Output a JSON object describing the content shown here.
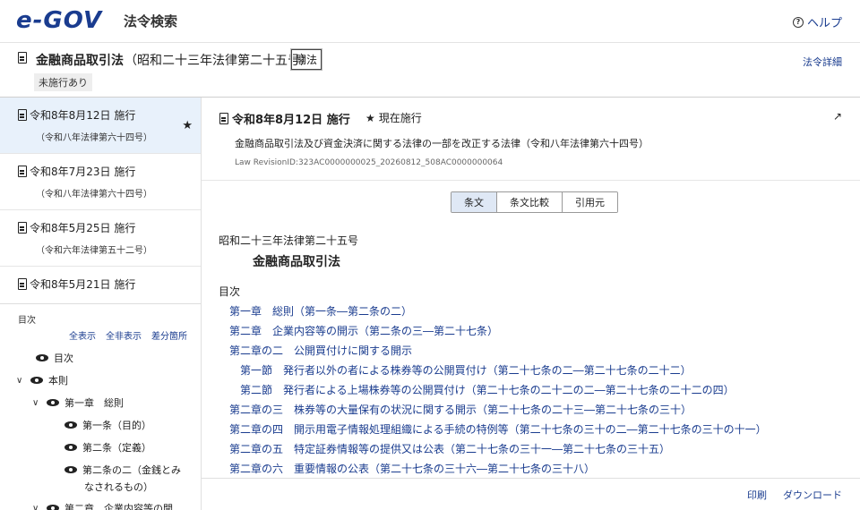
{
  "header": {
    "logo": "e-GOV",
    "app_title": "法令検索",
    "help": "ヘルプ"
  },
  "law": {
    "name": "金融商品取引法",
    "number": "（昭和二十三年法律第二十五号）",
    "badge": "閣法",
    "status": "未施行あり",
    "detail_link": "法令詳細"
  },
  "revisions": [
    {
      "date": "令和8年8月12日 施行",
      "law": "（令和八年法律第六十四号）",
      "active": true
    },
    {
      "date": "令和8年7月23日 施行",
      "law": "（令和八年法律第六十四号）",
      "active": false
    },
    {
      "date": "令和8年5月25日 施行",
      "law": "（令和六年法律第五十二号）",
      "active": false
    },
    {
      "date": "令和8年5月21日 施行",
      "law": "",
      "active": false
    }
  ],
  "toc_panel": {
    "label": "目次",
    "show_all": "全表示",
    "hide_all": "全非表示",
    "diff": "差分箇所",
    "tree": [
      {
        "label": "目次",
        "level": 0,
        "chevron": ""
      },
      {
        "label": "本則",
        "level": 0,
        "chevron": "∨"
      },
      {
        "label": "第一章　総則",
        "level": 1,
        "chevron": "∨"
      },
      {
        "label": "第一条（目的）",
        "level": 2,
        "chevron": ""
      },
      {
        "label": "第二条（定義）",
        "level": 2,
        "chevron": ""
      },
      {
        "label": "第二条の二（金銭とみ",
        "level": 2,
        "chevron": ""
      },
      {
        "label": "なされるもの）",
        "level": 2,
        "chevron": "",
        "continuation": true
      },
      {
        "label": "第二章　企業内容等の開",
        "level": 1,
        "chevron": "∨"
      }
    ]
  },
  "revision_head": {
    "title": "令和8年8月12日 施行",
    "current": "現在施行",
    "description": "金融商品取引法及び資金決済に関する法律の一部を改正する法律（令和八年法律第六十四号）",
    "revision_id": "Law RevisionID:323AC0000000025_20260812_508AC0000000064"
  },
  "tabs": [
    {
      "label": "条文",
      "active": true
    },
    {
      "label": "条文比較",
      "active": false
    },
    {
      "label": "引用元",
      "active": false
    }
  ],
  "content": {
    "law_number": "昭和二十三年法律第二十五号",
    "law_title": "金融商品取引法",
    "toc_heading": "目次",
    "toc_links": [
      {
        "text": "第一章　総則（第一条―第二条の二）",
        "indent": 0
      },
      {
        "text": "第二章　企業内容等の開示（第二条の三―第二十七条）",
        "indent": 0
      },
      {
        "text": "第二章の二　公開買付けに関する開示",
        "indent": 0
      },
      {
        "text": "第一節　発行者以外の者による株券等の公開買付け（第二十七条の二―第二十七条の二十二）",
        "indent": 1
      },
      {
        "text": "第二節　発行者による上場株券等の公開買付け（第二十七条の二十二の二―第二十七条の二十二の四）",
        "indent": 1
      },
      {
        "text": "第二章の三　株券等の大量保有の状況に関する開示（第二十七条の二十三―第二十七条の三十）",
        "indent": 0
      },
      {
        "text": "第二章の四　開示用電子情報処理組織による手続の特例等（第二十七条の三十の二―第二十七条の三十の十一）",
        "indent": 0
      },
      {
        "text": "第二章の五　特定証券情報等の提供又は公表（第二十七条の三十一―第二十七条の三十五）",
        "indent": 0
      },
      {
        "text": "第二章の六　重要情報の公表（第二十七条の三十六―第二十七条の三十八）",
        "indent": 0
      }
    ]
  },
  "footer": {
    "print": "印刷",
    "download": "ダウンロード"
  }
}
